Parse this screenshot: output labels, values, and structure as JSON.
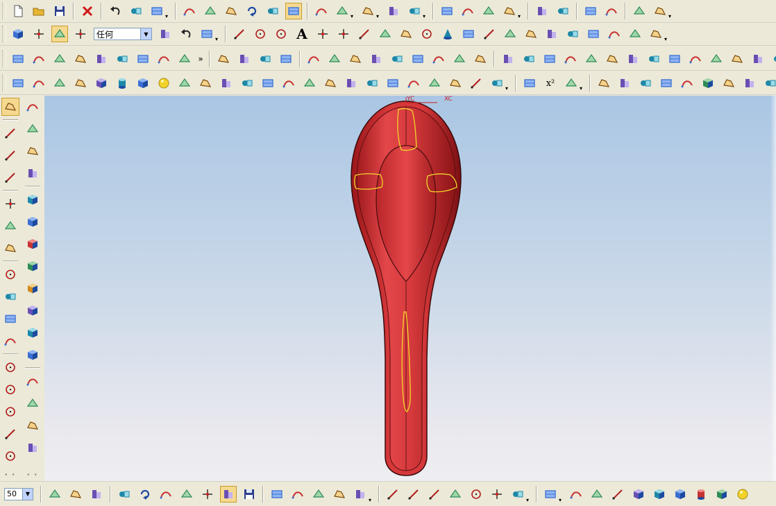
{
  "colors": {
    "toolbar_bg": "#ece9d8",
    "viewport_top": "#aac6e4",
    "viewport_bottom": "#eeeef2",
    "model_red": "#d8383a",
    "model_dark": "#8c1215",
    "highlight_yellow": "#f2d62a",
    "csys_red": "#c81e1e"
  },
  "toolbar_row1": {
    "icons": [
      "new-icon",
      "open-icon",
      "save-icon",
      "delete-icon",
      "undo-icon",
      "edit-object-icon",
      "display-properties-icon",
      "fit-view-icon",
      "zoom-window-icon",
      "zoom-icon",
      "rotate-icon",
      "pan-icon",
      "shaded-icon",
      "wireframe-icon",
      "view-orientation-icon",
      "hide-icon",
      "shaded-edges-icon",
      "section-view-icon",
      "tangent-icon",
      "curve-analysis-icon",
      "radius-icon",
      "surface-analysis-icon",
      "layer-icon",
      "layer-settings-icon",
      "move-object-icon",
      "transform-icon",
      "lock-icon",
      "assembly-icon"
    ]
  },
  "toolbar_row2": {
    "filter_select": {
      "value": "任何"
    },
    "text_tool_label": "A",
    "icons": [
      "part-icon",
      "point-constructor-icon",
      "selection-icon",
      "snap-point-icon",
      "move-origin-icon",
      "undo-arrow-icon",
      "orient-icon",
      "line-icon",
      "arc-icon",
      "circle-icon",
      "text-icon",
      "point-icon",
      "point-set-icon",
      "polyline-icon",
      "rectangle-icon",
      "polygon-icon",
      "ellipse-icon",
      "cone-icon",
      "helix-icon",
      "spline-icon",
      "offset-curve-icon",
      "bridge-curve-icon",
      "project-curve-icon",
      "wrap-curve-icon",
      "extract-curve-icon",
      "intersection-curve-icon",
      "section-curve-icon",
      "law-curve-icon"
    ]
  },
  "toolbar_row3": {
    "overflow_label": "»",
    "icons": [
      "surface-grid-icon",
      "plane-icon",
      "ruled-surface-icon",
      "through-curves-icon",
      "mesh-icon",
      "swept-icon",
      "section-surface-icon",
      "bridge-surface-icon",
      "n-sided-icon",
      "extension-icon",
      "offset-surface-icon",
      "trim-icon",
      "sew-icon",
      "thicken-icon",
      "studio-surface-icon",
      "blend-icon",
      "global-shape-icon",
      "x-form-icon",
      "enlarge-icon",
      "match-edge-icon",
      "flange-icon",
      "patch-icon",
      "replace-icon",
      "refit-icon",
      "smooth-icon",
      "transition-icon",
      "styled-sweep-icon",
      "styled-blend-icon",
      "extract-geometry-icon",
      "quilt-icon",
      "silhouette-icon",
      "shape-icon",
      "variable-offset-icon",
      "curvature-icon",
      "face-blend-icon",
      "soft-blend-icon"
    ]
  },
  "toolbar_row4": {
    "superscript_label": "x²",
    "icons": [
      "extrude-icon",
      "revolve-icon",
      "sweep-icon",
      "tube-icon",
      "block-icon",
      "cylinder-icon",
      "cone-solid-icon",
      "sphere-icon",
      "boss-icon",
      "hole-icon",
      "pocket-icon",
      "pad-icon",
      "slot-icon",
      "groove-icon",
      "shell-icon",
      "thread-icon",
      "offset-face-icon",
      "scale-body-icon",
      "draft-icon",
      "edge-blend-icon",
      "chamfer-icon",
      "datum-plane-icon",
      "datum-axis-icon",
      "ruler-icon",
      "protractor-icon",
      "expression-icon",
      "mirror-icon",
      "pattern-icon",
      "split-body-icon",
      "boolean-unite-icon",
      "boolean-subtract-icon",
      "boolean-intersect-icon",
      "sew-solid-icon",
      "patch-body-icon",
      "wrap-geometry-icon",
      "synchronous-icon",
      "delete-face-icon"
    ]
  },
  "left_column_a": {
    "icons": [
      "sketch-icon",
      "line-tool-icon",
      "axis-tool-icon",
      "dimension-icon",
      "point-on-curve-icon",
      "fillet-curve-icon",
      "offset-sketch-icon",
      "arc-curve-icon",
      "trim-curve-icon",
      "corner-icon",
      "extend-icon",
      "circle-tool-icon",
      "circle-center-icon",
      "circle-tangent-icon",
      "circle-dimension-icon",
      "circle-point-icon"
    ]
  },
  "left_column_b": {
    "icons": [
      "layout-icon",
      "book-icon",
      "shield-icon",
      "gear-box-icon",
      "cube-view-1-icon",
      "cube-view-2-icon",
      "cube-view-3-icon",
      "cube-view-4-icon",
      "cube-view-5-icon",
      "cube-view-6-icon",
      "cube-view-7-icon",
      "cube-view-8-icon",
      "move-face-icon",
      "blend-face-icon",
      "feature-cap-icon",
      "draft-face-icon"
    ]
  },
  "bottom_bar": {
    "zoom_value": "50",
    "icons": [
      "layers-icon",
      "wcs-icon",
      "wcs-dynamic-icon",
      "wcs-origin-icon",
      "wcs-rotate-icon",
      "wcs-orient-icon",
      "wcs-set-icon",
      "wcs-origin-point-icon",
      "wcs-active-icon",
      "wcs-save-icon",
      "snap-icon",
      "quick-pick-icon",
      "transform-view-icon",
      "copy-view-icon",
      "move-view-icon",
      "line-sketch-icon",
      "line-sketch-2-icon",
      "spline-sketch-icon",
      "cross-sketch-icon",
      "circle-sketch-icon",
      "point-sketch-icon",
      "plus-sketch-icon",
      "view-box-icon",
      "body-green-icon",
      "face-icon",
      "face-outline-icon",
      "block-solid-icon",
      "cylinder-solid-icon",
      "cube-solid-icon",
      "cylinder-blue-icon",
      "cone-solid-blue-icon",
      "sphere-icon"
    ]
  },
  "viewport": {
    "yc_label": "YC",
    "xc_label": "XC"
  }
}
